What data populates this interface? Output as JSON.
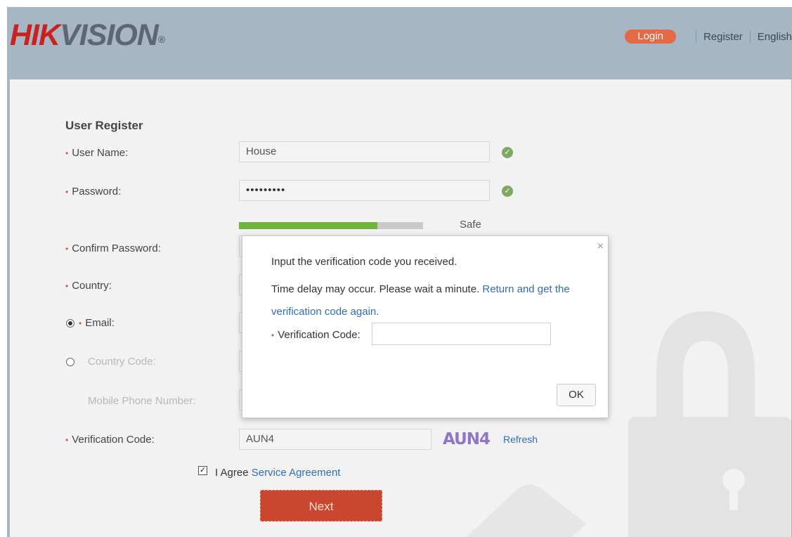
{
  "header": {
    "logo_red": "HIK",
    "logo_gray": "VISION",
    "logo_mark": "®",
    "login_label": "Login",
    "register_label": "Register",
    "language_label": "English"
  },
  "form": {
    "title": "User Register",
    "username": {
      "label": "User Name:",
      "value": "House"
    },
    "password": {
      "label": "Password:",
      "value": "•••••••••"
    },
    "strength": {
      "label": "Safe",
      "level": 0.75
    },
    "confirm_password": {
      "label": "Confirm Password:"
    },
    "country": {
      "label": "Country:"
    },
    "email": {
      "label": "Email:"
    },
    "country_code": {
      "label": "Country Code:"
    },
    "mobile": {
      "label": "Mobile Phone Number:"
    },
    "verification": {
      "label": "Verification Code:",
      "value": "AUN4"
    },
    "captcha_text": "AUN4",
    "refresh_label": "Refresh",
    "agree_text": "I Agree",
    "agreement_link": "Service Agreement",
    "next_label": "Next"
  },
  "modal": {
    "line1": "Input the verification code you received.",
    "line2": "Time delay may occur. Please wait a minute.",
    "link": "Return and get the verification code again.",
    "code_label": "Verification Code:",
    "code_value": "",
    "ok_label": "OK",
    "close_glyph": "×"
  },
  "colors": {
    "accent": "#e36a44",
    "link": "#2f6eb5",
    "success": "#7fa865"
  }
}
